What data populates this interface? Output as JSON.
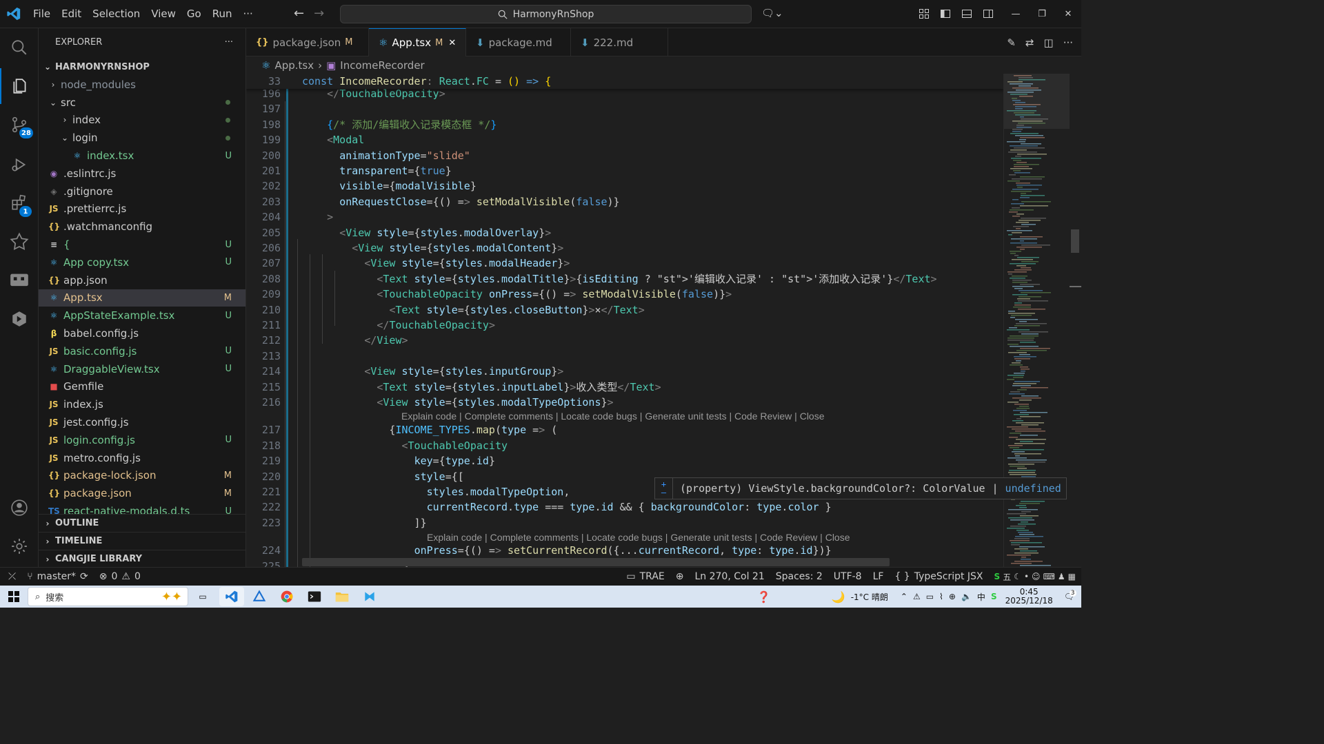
{
  "titlebar": {
    "menu": [
      "File",
      "Edit",
      "Selection",
      "View",
      "Go",
      "Run",
      "···"
    ],
    "search_text": "HarmonyRnShop"
  },
  "activity_bar": {
    "scm_badge": "28",
    "extensions_badge": "1"
  },
  "explorer": {
    "header": "EXPLORER",
    "more": "···",
    "project": "HARMONYRNSHOP",
    "items": [
      {
        "label": "node_modules",
        "kind": "folder",
        "depth": 1,
        "chev": "›",
        "status": "",
        "color": "#8b949e"
      },
      {
        "label": "src",
        "kind": "folder",
        "depth": 1,
        "chev": "⌄",
        "status": "dot",
        "color": "#cccccc"
      },
      {
        "label": "index",
        "kind": "folder",
        "depth": 2,
        "chev": "›",
        "status": "dot",
        "color": "#cccccc"
      },
      {
        "label": "login",
        "kind": "folder",
        "depth": 2,
        "chev": "⌄",
        "status": "dot",
        "color": "#cccccc"
      },
      {
        "label": "index.tsx",
        "kind": "tsx",
        "depth": 3,
        "status": "U",
        "color": "#73c991"
      },
      {
        "label": ".eslintrc.js",
        "kind": "eslint",
        "depth": 1,
        "status": "",
        "color": "#cccccc"
      },
      {
        "label": ".gitignore",
        "kind": "git",
        "depth": 1,
        "status": "",
        "color": "#cccccc"
      },
      {
        "label": ".prettierrc.js",
        "kind": "js",
        "depth": 1,
        "status": "",
        "color": "#cccccc"
      },
      {
        "label": ".watchmanconfig",
        "kind": "json",
        "depth": 1,
        "status": "",
        "color": "#cccccc"
      },
      {
        "label": "{",
        "kind": "text",
        "depth": 1,
        "status": "U",
        "color": "#73c991"
      },
      {
        "label": "App copy.tsx",
        "kind": "tsx",
        "depth": 1,
        "status": "U",
        "color": "#73c991"
      },
      {
        "label": "app.json",
        "kind": "json",
        "depth": 1,
        "status": "",
        "color": "#cccccc"
      },
      {
        "label": "App.tsx",
        "kind": "tsx",
        "depth": 1,
        "status": "M",
        "color": "#e2c08d",
        "selected": true
      },
      {
        "label": "AppStateExample.tsx",
        "kind": "tsx",
        "depth": 1,
        "status": "U",
        "color": "#73c991"
      },
      {
        "label": "babel.config.js",
        "kind": "babel",
        "depth": 1,
        "status": "",
        "color": "#cccccc"
      },
      {
        "label": "basic.config.js",
        "kind": "js",
        "depth": 1,
        "status": "U",
        "color": "#73c991"
      },
      {
        "label": "DraggableView.tsx",
        "kind": "tsx",
        "depth": 1,
        "status": "U",
        "color": "#73c991"
      },
      {
        "label": "Gemfile",
        "kind": "gem",
        "depth": 1,
        "status": "",
        "color": "#cccccc"
      },
      {
        "label": "index.js",
        "kind": "js",
        "depth": 1,
        "status": "",
        "color": "#cccccc"
      },
      {
        "label": "jest.config.js",
        "kind": "js",
        "depth": 1,
        "status": "",
        "color": "#cccccc"
      },
      {
        "label": "login.config.js",
        "kind": "js",
        "depth": 1,
        "status": "U",
        "color": "#73c991"
      },
      {
        "label": "metro.config.js",
        "kind": "js",
        "depth": 1,
        "status": "",
        "color": "#cccccc"
      },
      {
        "label": "package-lock.json",
        "kind": "json",
        "depth": 1,
        "status": "M",
        "color": "#e2c08d"
      },
      {
        "label": "package.json",
        "kind": "json",
        "depth": 1,
        "status": "M",
        "color": "#e2c08d"
      },
      {
        "label": "react-native-modals.d.ts",
        "kind": "ts",
        "depth": 1,
        "status": "U",
        "color": "#73c991"
      }
    ],
    "sections": [
      "OUTLINE",
      "TIMELINE",
      "CANGJIE LIBRARY"
    ]
  },
  "tabs": [
    {
      "label": "package.json",
      "mod": "M",
      "icon": "{}",
      "active": false
    },
    {
      "label": "App.tsx",
      "mod": "M",
      "icon": "⚛",
      "active": true,
      "close": "✕"
    },
    {
      "label": "package.md",
      "mod": "",
      "icon": "⬇",
      "active": false
    },
    {
      "label": "222.md",
      "mod": "",
      "icon": "⬇",
      "active": false
    }
  ],
  "breadcrumb": {
    "file": "App.tsx",
    "sep": "›",
    "symbol": "IncomeRecorder"
  },
  "editor": {
    "sticky_line": {
      "num": "33",
      "text": "const IncomeRecorder: React.FC = () => {"
    },
    "lines": [
      {
        "num": "196",
        "text": "    </TouchableOpacity>"
      },
      {
        "num": "197",
        "text": ""
      },
      {
        "num": "198",
        "text": "    {/* 添加/编辑收入记录模态框 */}"
      },
      {
        "num": "199",
        "text": "    <Modal"
      },
      {
        "num": "200",
        "text": "      animationType=\"slide\""
      },
      {
        "num": "201",
        "text": "      transparent={true}"
      },
      {
        "num": "202",
        "text": "      visible={modalVisible}"
      },
      {
        "num": "203",
        "text": "      onRequestClose={() => setModalVisible(false)}"
      },
      {
        "num": "204",
        "text": "    >"
      },
      {
        "num": "205",
        "text": "      <View style={styles.modalOverlay}>"
      },
      {
        "num": "206",
        "text": "        <View style={styles.modalContent}>"
      },
      {
        "num": "207",
        "text": "          <View style={styles.modalHeader}>"
      },
      {
        "num": "208",
        "text": "            <Text style={styles.modalTitle}>{isEditing ? '编辑收入记录' : '添加收入记录'}</Text>"
      },
      {
        "num": "209",
        "text": "            <TouchableOpacity onPress={() => setModalVisible(false)}>"
      },
      {
        "num": "210",
        "text": "              <Text style={styles.closeButton}>×</Text>"
      },
      {
        "num": "211",
        "text": "            </TouchableOpacity>"
      },
      {
        "num": "212",
        "text": "          </View>"
      },
      {
        "num": "213",
        "text": ""
      },
      {
        "num": "214",
        "text": "          <View style={styles.inputGroup}>"
      },
      {
        "num": "215",
        "text": "            <Text style={styles.inputLabel}>收入类型</Text>"
      },
      {
        "num": "216",
        "text": "            <View style={styles.modalTypeOptions}>"
      },
      {
        "num": "217",
        "text": "              {INCOME_TYPES.map(type => ("
      },
      {
        "num": "218",
        "text": "                <TouchableOpacity"
      },
      {
        "num": "219",
        "text": "                  key={type.id}"
      },
      {
        "num": "220",
        "text": "                  style={["
      },
      {
        "num": "221",
        "text": "                    styles.modalTypeOption,"
      },
      {
        "num": "222",
        "text": "                    currentRecord.type === type.id && { backgroundColor: type.color }"
      },
      {
        "num": "223",
        "text": "                  ]}"
      },
      {
        "num": "224",
        "text": "                  onPress={() => setCurrentRecord({...currentRecord, type: type.id})}"
      },
      {
        "num": "225",
        "text": "                >"
      }
    ],
    "codelens_1": "Explain code | Complete comments | Locate code bugs | Generate unit tests | Code Review | Close",
    "codelens_2": "Explain code | Complete comments | Locate code bugs | Generate unit tests | Code Review | Close"
  },
  "hover": {
    "text_1": "(property) ViewStyle.backgroundColor?: ColorValue",
    "sep": "|",
    "text_2": "undefined"
  },
  "statusbar": {
    "branch": "master*",
    "errors": "0",
    "warnings": "0",
    "trae": "TRAE",
    "position": "Ln 270, Col 21",
    "spaces": "Spaces: 2",
    "encoding": "UTF-8",
    "eol": "LF",
    "language": "TypeScript JSX",
    "ime": "五"
  },
  "taskbar": {
    "search_placeholder": "搜索",
    "weather": "-1°C 晴朗",
    "time": "0:45",
    "date": "2025/12/18",
    "notif_count": "3"
  }
}
